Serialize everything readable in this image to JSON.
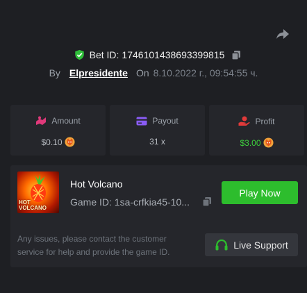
{
  "header": {
    "share_icon": "share-arrow-icon",
    "bet_label": "Bet ID:",
    "bet_id": "1746101438693399815",
    "copy_icon": "copy-icon",
    "verified_icon": "shield-check-icon",
    "by_label": "By",
    "username": "Elpresidente",
    "on_label": "On",
    "date": "8.10.2022 г., 09:54:55 ч."
  },
  "stats": [
    {
      "label": "Amount",
      "value": "$0.10",
      "icon": "amount-icon",
      "icon_color": "#e0397a",
      "coin": "shib-coin-icon"
    },
    {
      "label": "Payout",
      "value": "31 x",
      "icon": "card-icon",
      "icon_color": "#8a5cf5"
    },
    {
      "label": "Profit",
      "value": "$3.00",
      "icon": "profit-hand-icon",
      "icon_color": "#e23a3a",
      "value_color": "#3cd13c",
      "coin": "shib-coin-icon"
    }
  ],
  "game": {
    "thumb_text_1": "HOT",
    "thumb_text_2": "VOLCANO",
    "title": "Hot Volcano",
    "id_label": "Game ID:",
    "id_value": "1sa-crfkia45-10...",
    "play_label": "Play Now",
    "help_text": "Any issues, please contact the customer service for help and provide the game ID.",
    "support_label": "Live Support",
    "support_icon": "headset-icon"
  },
  "colors": {
    "background": "#1e1f23",
    "card": "#25262b",
    "accent_green": "#2dbd2d"
  }
}
